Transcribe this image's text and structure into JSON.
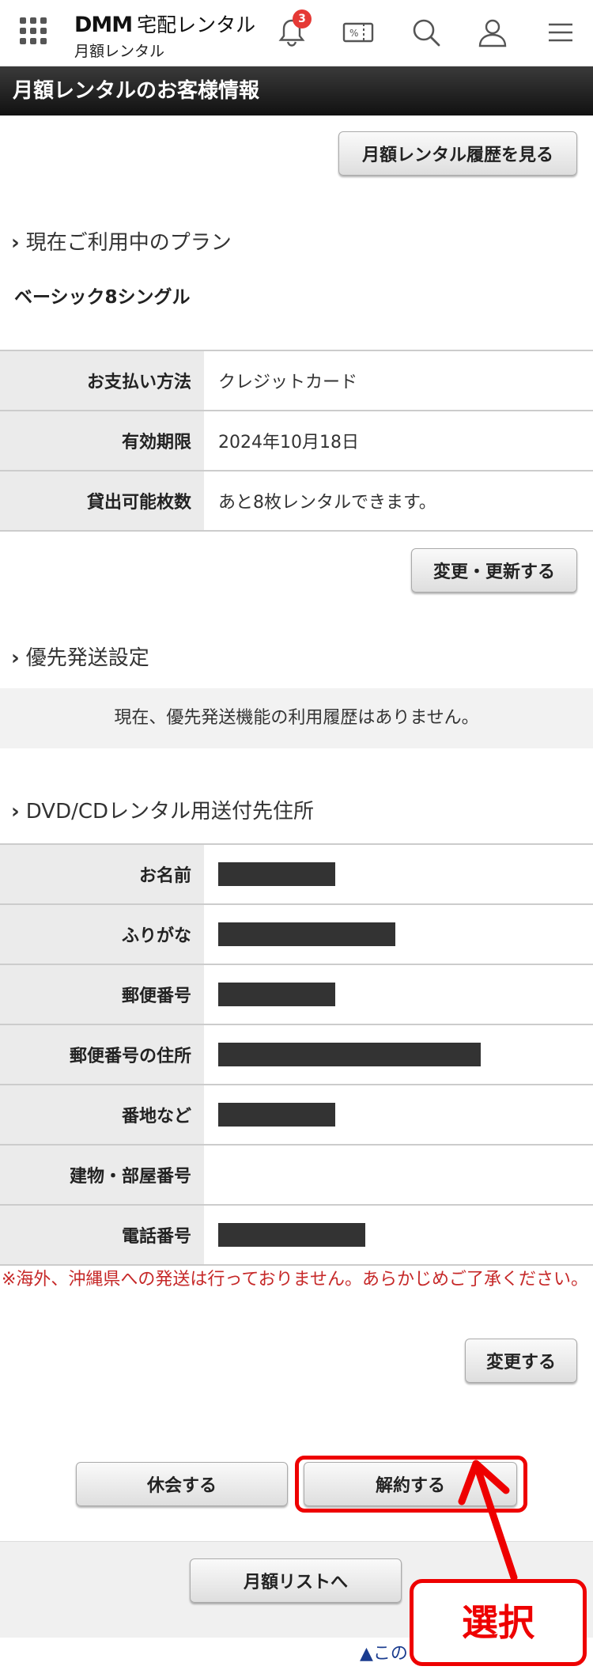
{
  "header": {
    "logo_brand": "DMM",
    "logo_service": "宅配レンタル",
    "logo_sub": "月額レンタル",
    "notification_count": "3",
    "icons": [
      "grid-menu-icon",
      "bell-icon",
      "coupon-icon",
      "search-icon",
      "user-icon",
      "hamburger-menu-icon"
    ]
  },
  "page_title": "月額レンタルのお客様情報",
  "history_button": "月額レンタル履歴を見る",
  "plan": {
    "heading": "現在ご利用中のプラン",
    "name": "ベーシック8シングル",
    "rows": [
      {
        "label": "お支払い方法",
        "value": "クレジットカード"
      },
      {
        "label": "有効期限",
        "value": "2024年10月18日"
      },
      {
        "label": "貸出可能枚数",
        "value": "あと8枚レンタルできます。"
      }
    ],
    "change_button": "変更・更新する"
  },
  "priority": {
    "heading": "優先発送設定",
    "notice": "現在、優先発送機能の利用履歴はありません。"
  },
  "address": {
    "heading": "DVD/CDレンタル用送付先住所",
    "rows": [
      {
        "label": "お名前"
      },
      {
        "label": "ふりがな"
      },
      {
        "label": "郵便番号"
      },
      {
        "label": "郵便番号の住所"
      },
      {
        "label": "番地など"
      },
      {
        "label": "建物・部屋番号"
      },
      {
        "label": "電話番号"
      }
    ],
    "warning": "※海外、沖縄県への発送は行っておりません。あらかじめご了承ください。",
    "change_button": "変更する"
  },
  "actions": {
    "suspend_button": "休会する",
    "cancel_button": "解約する",
    "list_button": "月額リストへ",
    "page_top_link": "▲この"
  },
  "annotation": {
    "callout_text": "選択",
    "color": "#e00000"
  }
}
